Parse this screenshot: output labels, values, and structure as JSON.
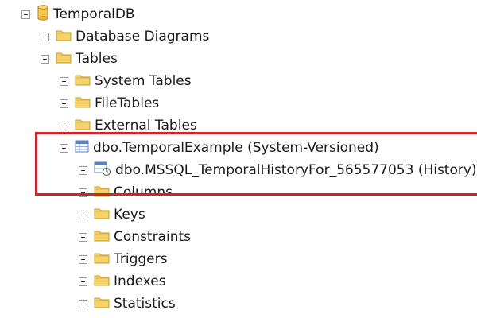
{
  "tree": {
    "root": {
      "label": "TemporalDB",
      "toggle": "minus",
      "icon": "database-icon"
    },
    "items": [
      {
        "label": "Database Diagrams",
        "toggle": "plus",
        "icon": "folder-icon"
      },
      {
        "label": "Tables",
        "toggle": "minus",
        "icon": "folder-icon"
      },
      {
        "label": "System Tables",
        "toggle": "plus",
        "icon": "folder-icon"
      },
      {
        "label": "FileTables",
        "toggle": "plus",
        "icon": "folder-icon"
      },
      {
        "label": "External Tables",
        "toggle": "plus",
        "icon": "folder-icon"
      },
      {
        "label": "dbo.TemporalExample (System-Versioned)",
        "toggle": "minus",
        "icon": "table-icon"
      },
      {
        "label": "dbo.MSSQL_TemporalHistoryFor_565577053 (History)",
        "toggle": "plus",
        "icon": "history-table-icon"
      },
      {
        "label": "Columns",
        "toggle": "plus",
        "icon": "folder-icon"
      },
      {
        "label": "Keys",
        "toggle": "plus",
        "icon": "folder-icon"
      },
      {
        "label": "Constraints",
        "toggle": "plus",
        "icon": "folder-icon"
      },
      {
        "label": "Triggers",
        "toggle": "plus",
        "icon": "folder-icon"
      },
      {
        "label": "Indexes",
        "toggle": "plus",
        "icon": "folder-icon"
      },
      {
        "label": "Statistics",
        "toggle": "plus",
        "icon": "folder-icon"
      }
    ]
  },
  "colors": {
    "highlight_border": "#d2232a",
    "folder_fill": "#f5d36b",
    "folder_stroke": "#c99a2a",
    "database_fill": "#f2c94c",
    "table_blue": "#5b7fbf"
  }
}
